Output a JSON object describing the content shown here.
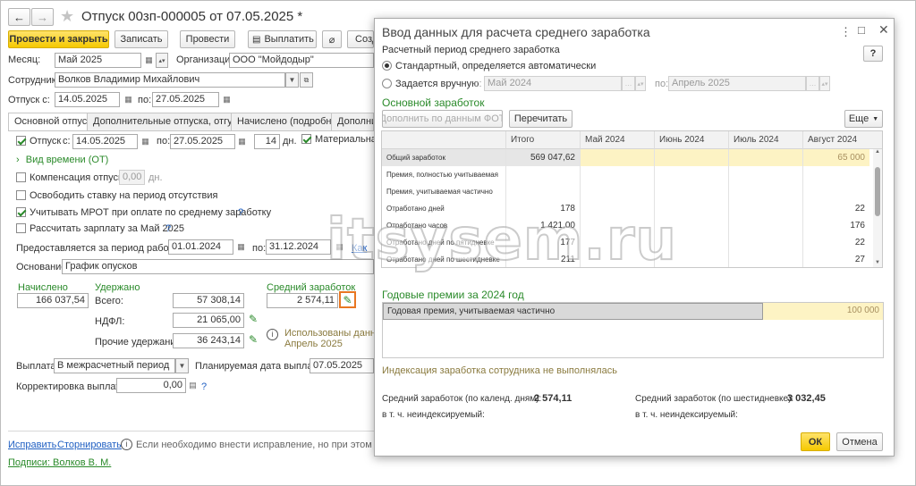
{
  "doc": {
    "title": "Отпуск 00зп-000005 от 07.05.2025 *",
    "toolbar": {
      "post_close": "Провести и закрыть",
      "save": "Записать",
      "post": "Провести",
      "pay": "Выплатить",
      "create": "Созд"
    },
    "month_label": "Месяц:",
    "month_value": "Май 2025",
    "org_label": "Организация:",
    "org_value": "ООО \"Мойдодыр\"",
    "employee_label": "Сотрудник:",
    "employee_value": "Волков Владимир Михайлович",
    "leave_from_label": "Отпуск с:",
    "leave_from_value": "14.05.2025",
    "leave_to_label": "по:",
    "leave_to_value": "27.05.2025",
    "tabs": [
      "Основной отпуск",
      "Дополнительные отпуска, отгулы",
      "Начислено (подробно)",
      "Дополни"
    ],
    "main": {
      "leave_cb_label": "Отпуск",
      "from_label": "с:",
      "from_value": "14.05.2025",
      "to_label": "по:",
      "to_value": "27.05.2025",
      "days_value": "14",
      "days_unit": "дн.",
      "material_label": "Материальная",
      "time_type_link": "Вид времени (ОТ)",
      "compensation_label": "Компенсация отпуска",
      "compensation_value": "0,00",
      "compensation_unit": "дн.",
      "release_rate_label": "Освободить ставку на период отсутствия",
      "mrot_label": "Учитывать МРОТ при оплате по среднему заработку",
      "calc_salary_label": "Рассчитать зарплату за Май 2025",
      "help": "?",
      "work_period_label": "Предоставляется за период работы с:",
      "work_from_value": "01.01.2024",
      "work_to_label": "по:",
      "work_to_value": "31.12.2024",
      "work_link": "Как",
      "basis_label": "Основание:",
      "basis_value": "График опусков",
      "accrued_header": "Начислено",
      "withheld_header": "Удержано",
      "avg_header": "Средний заработок",
      "accrued_value": "166 037,54",
      "total_label": "Всего:",
      "total_value": "57 308,14",
      "avg_value": "2 574,11",
      "ndfl_label": "НДФЛ:",
      "ndfl_value": "21 065,00",
      "other_label": "Прочие удержания:",
      "other_value": "36 243,14",
      "used_data_line1": "Использованы данные",
      "used_data_line2": "Апрель 2025",
      "payout_label": "Выплата:",
      "payout_value": "В межрасчетный период",
      "planned_date_label": "Планируемая дата выплаты:",
      "planned_date_value": "07.05.2025",
      "correction_label": "Корректировка выплаты:",
      "correction_value": "0,00"
    },
    "footer": {
      "fix_link": "Исправить",
      "reverse_link": "Сторнировать",
      "info_text": "Если необходимо внести исправление, но при этом сохранит",
      "signatures_link": "Подписи: Волков В. М."
    }
  },
  "modal": {
    "title": "Ввод данных для расчета среднего заработка",
    "period_label": "Расчетный период среднего заработка",
    "radio_auto": "Стандартный, определяется автоматически",
    "radio_manual": "Задается вручную",
    "from_label": "с:",
    "from_value": "Май 2024",
    "to_label": "по:",
    "to_value": "Апрель 2025",
    "help_btn": "?",
    "section_main": "Основной заработок",
    "fill_fot_btn": "Дополнить по данным ФОТ",
    "recalc_btn": "Перечитать",
    "more_btn": "Еще",
    "grid": {
      "headers": [
        "",
        "Итого",
        "Май 2024",
        "Июнь 2024",
        "Июль 2024",
        "Август 2024"
      ],
      "rows": [
        {
          "name": "Общий заработок",
          "total": "569 047,62",
          "aug": "65 000"
        },
        {
          "name": "Премия, полностью учитываемая",
          "total": "",
          "aug": ""
        },
        {
          "name": "Премия, учитываемая частично",
          "total": "",
          "aug": ""
        },
        {
          "name": "Отработано дней",
          "total": "178",
          "aug": "22"
        },
        {
          "name": "Отработано часов",
          "total": "1 421,00",
          "aug": "176"
        },
        {
          "name": "Отработано дней по пятидневке",
          "total": "177",
          "aug": "22"
        },
        {
          "name": "Отработано дней по шестидневке",
          "total": "211",
          "aug": "27"
        }
      ]
    },
    "section_annual": "Годовые премии за 2024 год",
    "annual_row_name": "Годовая премия, учитываемая частично",
    "annual_row_value": "100 000",
    "indexation_text": "Индексация заработка сотрудника не выполнялась",
    "avg_calendar_label": "Средний заработок (по календ. дням):",
    "avg_calendar_value": "2 574,11",
    "avg_six_label": "Средний заработок (по шестидневке):",
    "avg_six_value": "3 032,45",
    "non_indexed_label": "в т. ч. неиндексируемый:",
    "ok_btn": "ОК",
    "cancel_btn": "Отмена"
  },
  "watermark": "itsysem.ru",
  "colors": {
    "accent_green": "#2a8a2a",
    "highlight_orange": "#e87722",
    "yellow_cell": "#fdf3c4",
    "primary_button": "#f5c900"
  }
}
